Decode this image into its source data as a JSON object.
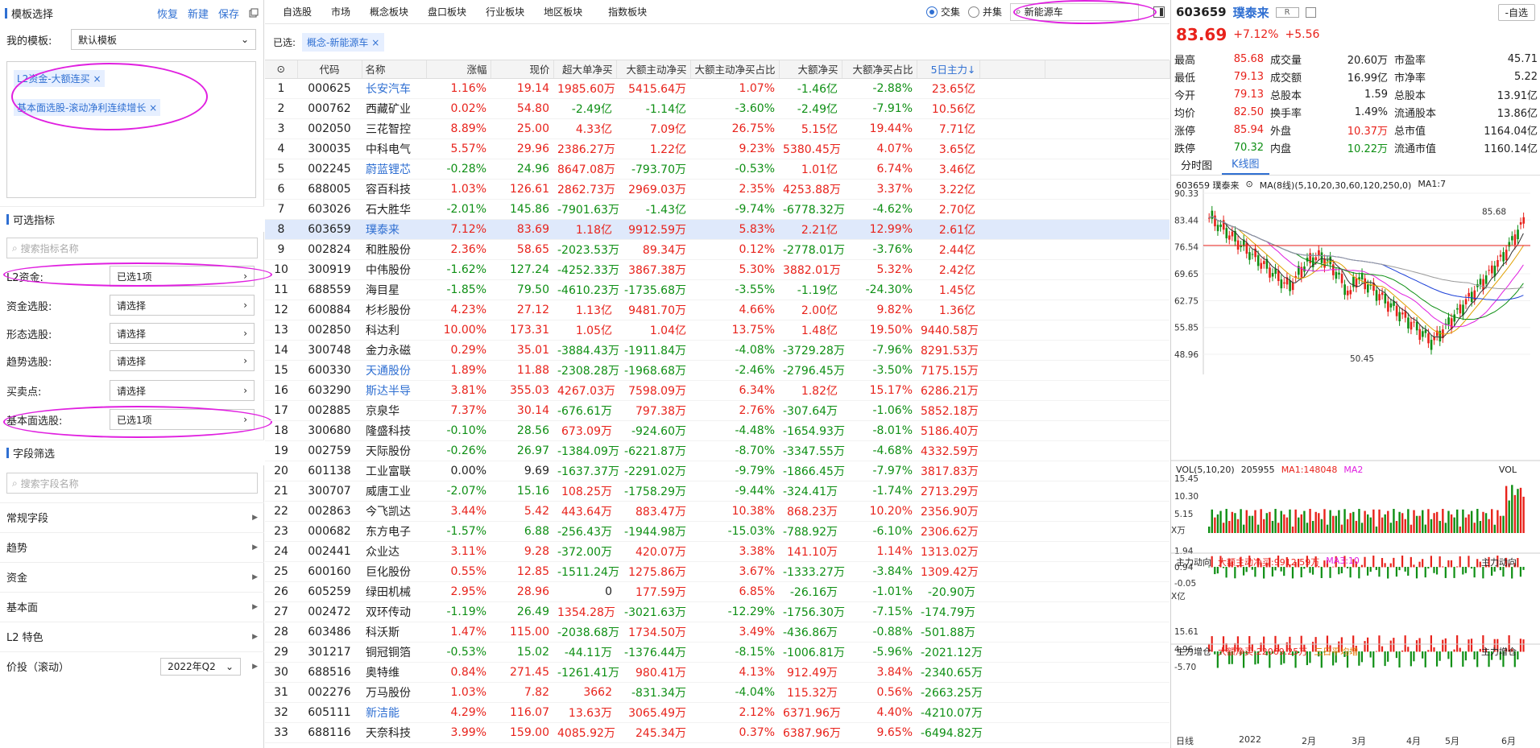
{
  "left": {
    "template_header": {
      "title": "模板选择",
      "restore": "恢复",
      "new": "新建",
      "save": "保存"
    },
    "my_template_label": "我的模板:",
    "my_template_value": "默认模板",
    "chips": [
      "L2资金-大额连买",
      "基本面选股-滚动净利连续增长"
    ],
    "optional_header": "可选指标",
    "indicator_search_placeholder": "搜索指标名称",
    "filters": [
      {
        "label": "L2资金:",
        "value": "已选1项"
      },
      {
        "label": "资金选股:",
        "value": "请选择"
      },
      {
        "label": "形态选股:",
        "value": "请选择"
      },
      {
        "label": "趋势选股:",
        "value": "请选择"
      },
      {
        "label": "买卖点:",
        "value": "请选择"
      },
      {
        "label": "基本面选股:",
        "value": "已选1项"
      }
    ],
    "field_header": "字段筛选",
    "field_search_placeholder": "搜索字段名称",
    "groups": [
      "常规字段",
      "趋势",
      "资金",
      "基本面",
      "L2 特色"
    ],
    "price_label": "价投（滚动）",
    "price_value": "2022年Q2"
  },
  "nav": {
    "tabs": [
      "自选股",
      "市场",
      "概念板块",
      "盘口板块",
      "行业板块",
      "地区板块",
      "指数板块"
    ],
    "radio_intersect": "交集",
    "radio_union": "并集",
    "search_value": "新能源车"
  },
  "chosen": {
    "label": "已选:",
    "chip": "概念-新能源车"
  },
  "table": {
    "headers": [
      "代码",
      "名称",
      "涨幅",
      "现价",
      "超大单净买",
      "大额主动净买",
      "大额主动净买占比",
      "大额净买",
      "大额净买占比",
      "5日主力↓"
    ],
    "rows": [
      [
        "1",
        "000625",
        "长安汽车",
        "1.16%",
        "19.14",
        "1985.60万",
        "5415.64万",
        "1.07%",
        "-1.46亿",
        "-2.88%",
        "23.65亿"
      ],
      [
        "2",
        "000762",
        "西藏矿业",
        "0.02%",
        "54.80",
        "-2.49亿",
        "-1.14亿",
        "-3.60%",
        "-2.49亿",
        "-7.91%",
        "10.56亿"
      ],
      [
        "3",
        "002050",
        "三花智控",
        "8.89%",
        "25.00",
        "4.33亿",
        "7.09亿",
        "26.75%",
        "5.15亿",
        "19.44%",
        "7.71亿"
      ],
      [
        "4",
        "300035",
        "中科电气",
        "5.57%",
        "29.96",
        "2386.27万",
        "1.22亿",
        "9.23%",
        "5380.45万",
        "4.07%",
        "3.65亿"
      ],
      [
        "5",
        "002245",
        "蔚蓝锂芯",
        "-0.28%",
        "24.96",
        "8647.08万",
        "-793.70万",
        "-0.53%",
        "1.01亿",
        "6.74%",
        "3.46亿"
      ],
      [
        "6",
        "688005",
        "容百科技",
        "1.03%",
        "126.61",
        "2862.73万",
        "2969.03万",
        "2.35%",
        "4253.88万",
        "3.37%",
        "3.22亿"
      ],
      [
        "7",
        "603026",
        "石大胜华",
        "-2.01%",
        "145.86",
        "-7901.63万",
        "-1.43亿",
        "-9.74%",
        "-6778.32万",
        "-4.62%",
        "2.70亿"
      ],
      [
        "8",
        "603659",
        "璞泰来",
        "7.12%",
        "83.69",
        "1.18亿",
        "9912.59万",
        "5.83%",
        "2.21亿",
        "12.99%",
        "2.61亿"
      ],
      [
        "9",
        "002824",
        "和胜股份",
        "2.36%",
        "58.65",
        "-2023.53万",
        "89.34万",
        "0.12%",
        "-2778.01万",
        "-3.76%",
        "2.44亿"
      ],
      [
        "10",
        "300919",
        "中伟股份",
        "-1.62%",
        "127.24",
        "-4252.33万",
        "3867.38万",
        "5.30%",
        "3882.01万",
        "5.32%",
        "2.42亿"
      ],
      [
        "11",
        "688559",
        "海目星",
        "-1.85%",
        "79.50",
        "-4610.23万",
        "-1735.68万",
        "-3.55%",
        "-1.19亿",
        "-24.30%",
        "1.45亿"
      ],
      [
        "12",
        "600884",
        "杉杉股份",
        "4.23%",
        "27.12",
        "1.13亿",
        "9481.70万",
        "4.66%",
        "2.00亿",
        "9.82%",
        "1.36亿"
      ],
      [
        "13",
        "002850",
        "科达利",
        "10.00%",
        "173.31",
        "1.05亿",
        "1.04亿",
        "13.75%",
        "1.48亿",
        "19.50%",
        "9440.58万"
      ],
      [
        "14",
        "300748",
        "金力永磁",
        "0.29%",
        "35.01",
        "-3884.43万",
        "-1911.84万",
        "-4.08%",
        "-3729.28万",
        "-7.96%",
        "8291.53万"
      ],
      [
        "15",
        "600330",
        "天通股份",
        "1.89%",
        "11.88",
        "-2308.28万",
        "-1968.68万",
        "-2.46%",
        "-2796.45万",
        "-3.50%",
        "7175.15万"
      ],
      [
        "16",
        "603290",
        "斯达半导",
        "3.81%",
        "355.03",
        "4267.03万",
        "7598.09万",
        "6.34%",
        "1.82亿",
        "15.17%",
        "6286.21万"
      ],
      [
        "17",
        "002885",
        "京泉华",
        "7.37%",
        "30.14",
        "-676.61万",
        "797.38万",
        "2.76%",
        "-307.64万",
        "-1.06%",
        "5852.18万"
      ],
      [
        "18",
        "300680",
        "隆盛科技",
        "-0.10%",
        "28.56",
        "673.09万",
        "-924.60万",
        "-4.48%",
        "-1654.93万",
        "-8.01%",
        "5186.40万"
      ],
      [
        "19",
        "002759",
        "天际股份",
        "-0.26%",
        "26.97",
        "-1384.09万",
        "-6221.87万",
        "-8.70%",
        "-3347.55万",
        "-4.68%",
        "4332.59万"
      ],
      [
        "20",
        "601138",
        "工业富联",
        "0.00%",
        "9.69",
        "-1637.37万",
        "-2291.02万",
        "-9.79%",
        "-1866.45万",
        "-7.97%",
        "3817.83万"
      ],
      [
        "21",
        "300707",
        "威唐工业",
        "-2.07%",
        "15.16",
        "108.25万",
        "-1758.29万",
        "-9.44%",
        "-324.41万",
        "-1.74%",
        "2713.29万"
      ],
      [
        "22",
        "002863",
        "今飞凯达",
        "3.44%",
        "5.42",
        "443.64万",
        "883.47万",
        "10.38%",
        "868.23万",
        "10.20%",
        "2356.90万"
      ],
      [
        "23",
        "000682",
        "东方电子",
        "-1.57%",
        "6.88",
        "-256.43万",
        "-1944.98万",
        "-15.03%",
        "-788.92万",
        "-6.10%",
        "2306.62万"
      ],
      [
        "24",
        "002441",
        "众业达",
        "3.11%",
        "9.28",
        "-372.00万",
        "420.07万",
        "3.38%",
        "141.10万",
        "1.14%",
        "1313.02万"
      ],
      [
        "25",
        "600160",
        "巨化股份",
        "0.55%",
        "12.85",
        "-1511.24万",
        "1275.86万",
        "3.67%",
        "-1333.27万",
        "-3.84%",
        "1309.42万"
      ],
      [
        "26",
        "605259",
        "绿田机械",
        "2.95%",
        "28.96",
        "0",
        "177.59万",
        "6.85%",
        "-26.16万",
        "-1.01%",
        "-20.90万"
      ],
      [
        "27",
        "002472",
        "双环传动",
        "-1.19%",
        "26.49",
        "1354.28万",
        "-3021.63万",
        "-12.29%",
        "-1756.30万",
        "-7.15%",
        "-174.79万"
      ],
      [
        "28",
        "603486",
        "科沃斯",
        "1.47%",
        "115.00",
        "-2038.68万",
        "1734.50万",
        "3.49%",
        "-436.86万",
        "-0.88%",
        "-501.88万"
      ],
      [
        "29",
        "301217",
        "铜冠铜箔",
        "-0.53%",
        "15.02",
        "-44.11万",
        "-1376.44万",
        "-8.15%",
        "-1006.81万",
        "-5.96%",
        "-2021.12万"
      ],
      [
        "30",
        "688516",
        "奥特维",
        "0.84%",
        "271.45",
        "-1261.41万",
        "980.41万",
        "4.13%",
        "912.49万",
        "3.84%",
        "-2340.65万"
      ],
      [
        "31",
        "002276",
        "万马股份",
        "1.03%",
        "7.82",
        "3662",
        "-831.34万",
        "-4.04%",
        "115.32万",
        "0.56%",
        "-2663.25万"
      ],
      [
        "32",
        "605111",
        "新洁能",
        "4.29%",
        "116.07",
        "13.63万",
        "3065.49万",
        "2.12%",
        "6371.96万",
        "4.40%",
        "-4210.07万"
      ],
      [
        "33",
        "688116",
        "天奈科技",
        "3.99%",
        "159.00",
        "4085.92万",
        "245.34万",
        "0.37%",
        "6387.96万",
        "9.65%",
        "-6494.82万"
      ]
    ],
    "highlight_row": 8,
    "blue_names": [
      "长安汽车",
      "蔚蓝锂芯",
      "璞泰来",
      "天通股份",
      "斯达半导",
      "新洁能"
    ]
  },
  "quote": {
    "code": "603659",
    "name": "璞泰来",
    "badge": "R",
    "add_watch": "-自选",
    "price": "83.69",
    "change_pct": "+7.12%",
    "change": "+5.56",
    "stats": [
      [
        [
          "最高",
          "85.68",
          "red"
        ],
        [
          "成交量",
          "20.60万",
          "blk"
        ],
        [
          "市盈率",
          "45.71",
          "blk"
        ]
      ],
      [
        [
          "最低",
          "79.13",
          "red"
        ],
        [
          "成交额",
          "16.99亿",
          "blk"
        ],
        [
          "市净率",
          "5.22",
          "blk"
        ]
      ],
      [
        [
          "今开",
          "79.13",
          "red"
        ],
        [
          "总股本",
          "1.59",
          "blk"
        ],
        [
          "总股本",
          "13.91亿",
          "blk"
        ]
      ],
      [
        [
          "均价",
          "82.50",
          "red"
        ],
        [
          "换手率",
          "1.49%",
          "blk"
        ],
        [
          "流通股本",
          "13.86亿",
          "blk"
        ]
      ],
      [
        [
          "涨停",
          "85.94",
          "red"
        ],
        [
          "外盘",
          "10.37万",
          "red"
        ],
        [
          "总市值",
          "1164.04亿",
          "blk"
        ]
      ],
      [
        [
          "跌停",
          "70.32",
          "green"
        ],
        [
          "内盘",
          "10.22万",
          "green"
        ],
        [
          "流通市值",
          "1160.14亿",
          "blk"
        ]
      ]
    ]
  },
  "kline": {
    "tabs": [
      "分时图",
      "K线图"
    ],
    "legend_code": "603659 璞泰来",
    "ma_label": "MA(8线)(5,10,20,30,60,120,250,0)",
    "ma1": "MA1:7",
    "y_ticks": [
      "90.33",
      "83.44",
      "76.54",
      "69.65",
      "62.75",
      "55.85",
      "48.96"
    ],
    "high_label": "85.68",
    "low_label": "50.45",
    "vol_label": "VOL(5,10,20)",
    "vol_value": "205955",
    "vol_ma1": "MA1:148048",
    "vol_ma2": "MA2",
    "vol_short": "VOL",
    "vol_ticks": [
      "15.45",
      "10.30",
      "5.15"
    ],
    "vol_unit": "X万",
    "flow_label": "主力动向",
    "flow_big": "大额主动净买:9912.59万",
    "flow_ma3": "MA3:10",
    "flow_ticks": [
      "1.94",
      "0.94",
      "-0.05"
    ],
    "flow_unit": "X亿",
    "inc_label": "主力增仓",
    "inc_big": "大额净买:22069.25万",
    "inc_avg": "三日平均增",
    "inc_ticks": [
      "15.61",
      "4.96",
      "-5.70"
    ],
    "x_labels": [
      "日线",
      "2022",
      "2月",
      "3月",
      "4月",
      "5月",
      "6月"
    ]
  }
}
